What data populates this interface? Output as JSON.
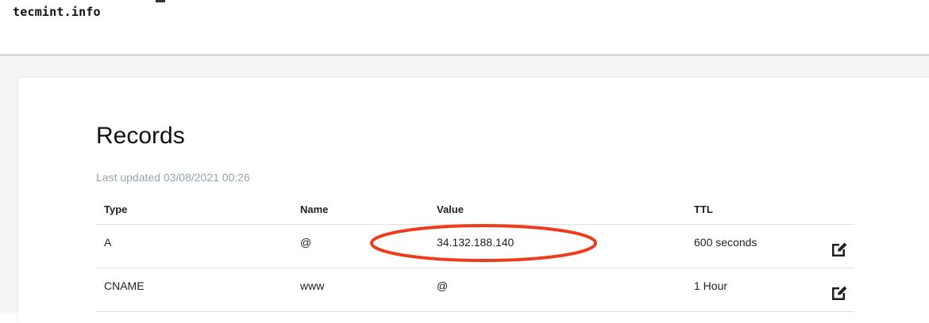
{
  "header": {
    "domain": "tecmint.info"
  },
  "records": {
    "title": "Records",
    "last_updated": "Last updated 03/08/2021 00:26",
    "columns": {
      "type": "Type",
      "name": "Name",
      "value": "Value",
      "ttl": "TTL"
    },
    "rows": [
      {
        "type": "A",
        "name": "@",
        "value": "34.132.188.140",
        "ttl": "600 seconds"
      },
      {
        "type": "CNAME",
        "name": "www",
        "value": "@",
        "ttl": "1 Hour"
      }
    ]
  },
  "annotation": {
    "color": "#ee3b1c"
  },
  "icons": {
    "edit": "edit-icon"
  }
}
